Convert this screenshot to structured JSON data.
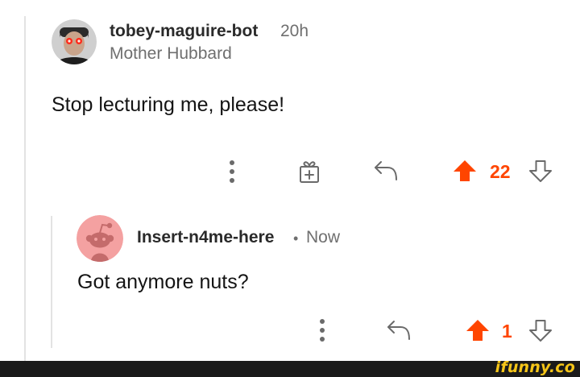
{
  "parent_comment": {
    "username": "tobey-maguire-bot",
    "age": "20h",
    "flair": "Mother Hubbard",
    "body": "Stop lecturing me, please!",
    "actions": {
      "more_icon": "more-vertical-icon",
      "award_icon": "gift-award-icon",
      "reply_icon": "reply-icon",
      "upvote_icon": "upvote-arrow-icon",
      "downvote_icon": "downvote-arrow-icon",
      "score": "22"
    }
  },
  "reply_comment": {
    "username": "Insert-n4me-here",
    "separator": "•",
    "age": "Now",
    "body": "Got anymore nuts?",
    "actions": {
      "more_icon": "more-vertical-icon",
      "reply_icon": "reply-icon",
      "upvote_icon": "upvote-arrow-icon",
      "downvote_icon": "downvote-arrow-icon",
      "score": "1"
    }
  },
  "colors": {
    "upvote": "#ff4500",
    "text": "#1c1c1c",
    "muted": "#6f6f6f",
    "thread_line": "#e3e3e3",
    "snoo_bg": "#f4a1a1",
    "watermark": "#f5c518"
  },
  "watermark": "ifunny.co"
}
